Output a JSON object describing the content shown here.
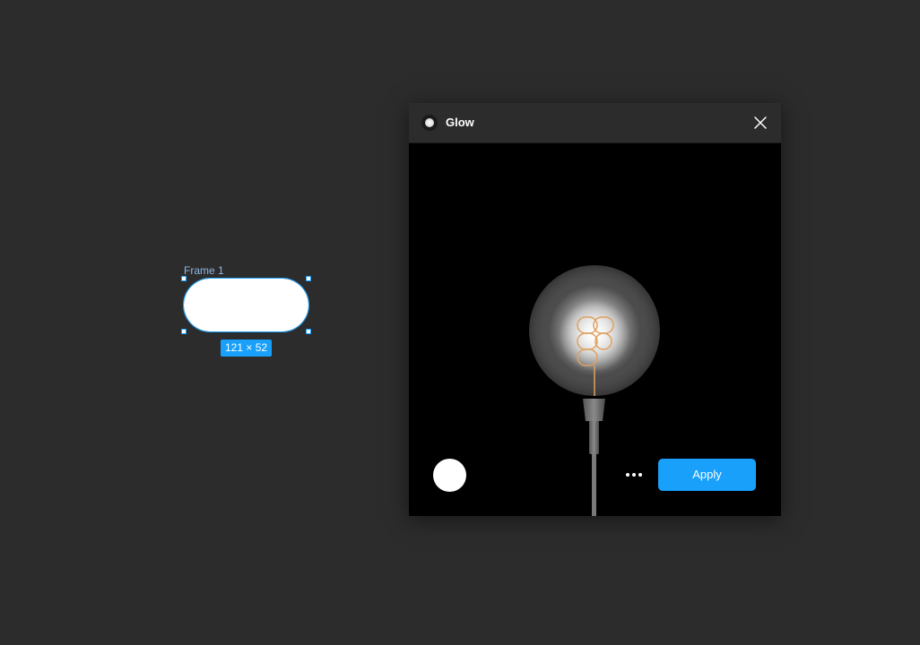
{
  "canvas": {
    "frame_label": "Frame 1",
    "frame_size": "121 × 52"
  },
  "plugin": {
    "title": "Glow",
    "apply_label": "Apply",
    "selected_color": "#ffffff"
  },
  "colors": {
    "accent": "#18a0fb",
    "canvas_bg": "#2c2c2c",
    "preview_bg": "#000000"
  },
  "icons": {
    "plugin": "glow-icon",
    "close": "close-icon",
    "more": "more-horizontal-icon"
  }
}
